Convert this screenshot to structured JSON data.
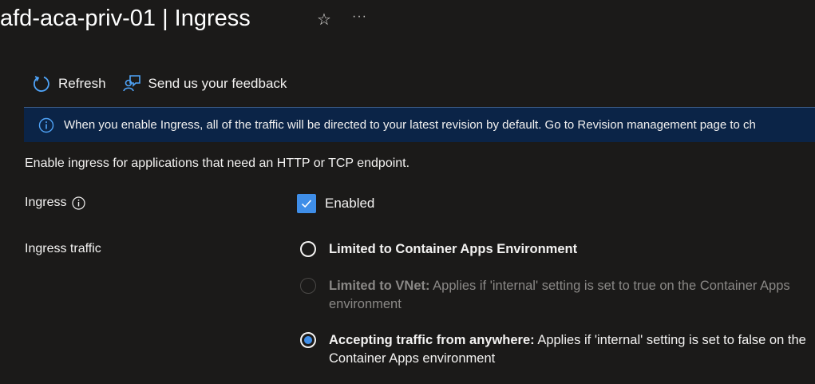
{
  "header": {
    "title": "afd-aca-priv-01 | Ingress",
    "favorite_icon": "star-icon",
    "more_icon": "more-ellipsis-icon",
    "more_label": "···"
  },
  "toolbar": {
    "refresh_label": "Refresh",
    "feedback_label": "Send us your feedback"
  },
  "banner": {
    "text": "When you enable Ingress, all of the traffic will be directed to your latest revision by default. Go to Revision management page to ch"
  },
  "description": "Enable ingress for applications that need an HTTP or TCP endpoint.",
  "ingress": {
    "label": "Ingress",
    "checked": true,
    "checkbox_label": "Enabled"
  },
  "ingress_traffic": {
    "label": "Ingress traffic",
    "options": [
      {
        "title": "Limited to Container Apps Environment",
        "detail": "",
        "selected": false,
        "disabled": false
      },
      {
        "title": "Limited to VNet:",
        "detail": " Applies if 'internal' setting is set to true on the Container Apps environment",
        "selected": false,
        "disabled": true
      },
      {
        "title": "Accepting traffic from anywhere:",
        "detail": " Applies if 'internal' setting is set to false on the Container Apps environment",
        "selected": true,
        "disabled": false
      }
    ]
  },
  "colors": {
    "background": "#1b1a19",
    "accent": "#3f8ee8",
    "banner_bg": "#0b2447"
  }
}
